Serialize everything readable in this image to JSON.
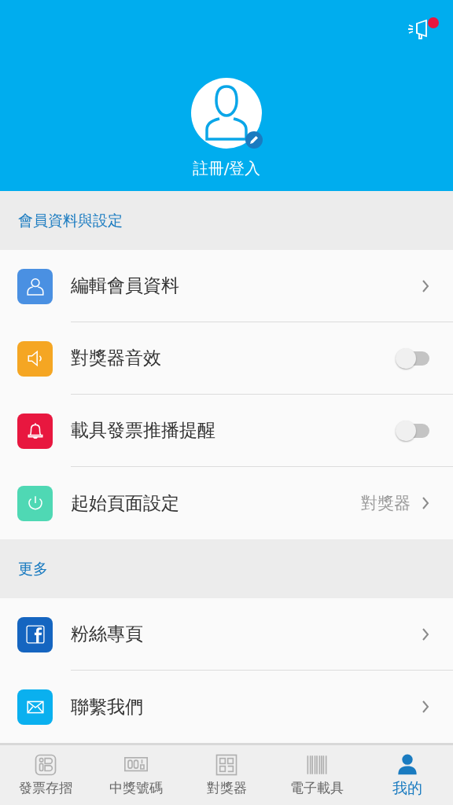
{
  "header": {
    "notification_badge": true,
    "login_label": "註冊/登入"
  },
  "sections": [
    {
      "title": "會員資料與設定",
      "items": [
        {
          "kind": "link",
          "label": "編輯會員資料",
          "color": "#4a90e2"
        },
        {
          "kind": "toggle",
          "label": "對獎器音效",
          "color": "#f5a623",
          "on": false
        },
        {
          "kind": "toggle",
          "label": "載具發票推播提醒",
          "color": "#e8173f",
          "on": false
        },
        {
          "kind": "value",
          "label": "起始頁面設定",
          "color": "#4fd8b4",
          "value": "對獎器"
        }
      ]
    },
    {
      "title": "更多",
      "items": [
        {
          "kind": "link",
          "label": "粉絲專頁",
          "color": "#1565c0"
        },
        {
          "kind": "link",
          "label": "聯繫我們",
          "color": "#0ab0ef"
        }
      ]
    }
  ],
  "tabs": [
    {
      "label": "發票存摺",
      "selected": false
    },
    {
      "label": "中獎號碼",
      "selected": false
    },
    {
      "label": "對獎器",
      "selected": false
    },
    {
      "label": "電子載具",
      "selected": false
    },
    {
      "label": "我的",
      "selected": true
    }
  ]
}
